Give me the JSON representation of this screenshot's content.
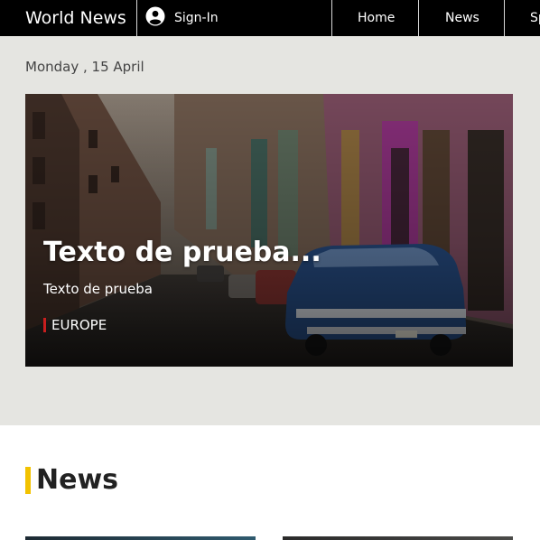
{
  "header": {
    "brand": "World News",
    "signin_label": "Sign-In",
    "nav": [
      {
        "label": "Home"
      },
      {
        "label": "News"
      },
      {
        "label": "Sp"
      }
    ]
  },
  "date_text": "Monday , 15 April",
  "hero": {
    "title": "Texto de prueba...",
    "subtitle": "Texto de prueba",
    "category": "EUROPE"
  },
  "news_section": {
    "heading": "News"
  },
  "colors": {
    "topbar": "#000000",
    "hero_band": "#e5e5e1",
    "category_accent": "#c81e1e",
    "news_accent": "#f2c200"
  }
}
